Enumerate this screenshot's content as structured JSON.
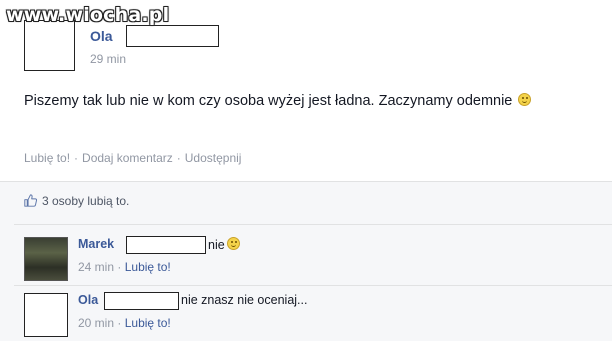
{
  "watermark": "www.wiocha.pl",
  "post": {
    "author": "Ola",
    "time": "29 min",
    "text": "Piszemy tak lub nie w kom czy osoba wyżej jest ładna. Zaczynamy odemnie",
    "emoji_icon": "smiley-icon",
    "actions": {
      "like": "Lubię to!",
      "comment": "Dodaj komentarz",
      "share": "Udostępnij",
      "separator": "·"
    }
  },
  "likes": {
    "summary": "3 osoby lubią to.",
    "icon": "thumbs-up-icon"
  },
  "comments": [
    {
      "author": "Marek",
      "text": "nie",
      "emoji": true,
      "time": "24 min",
      "like": "Lubię to!",
      "separator": "·"
    },
    {
      "author": "Ola",
      "text": "nie znasz nie oceniaj...",
      "emoji": false,
      "time": "20 min",
      "like": "Lubię to!",
      "separator": "·"
    }
  ],
  "colors": {
    "link": "#3b5998",
    "meta": "#9197a3",
    "feedback_bg": "#f6f7f9"
  }
}
